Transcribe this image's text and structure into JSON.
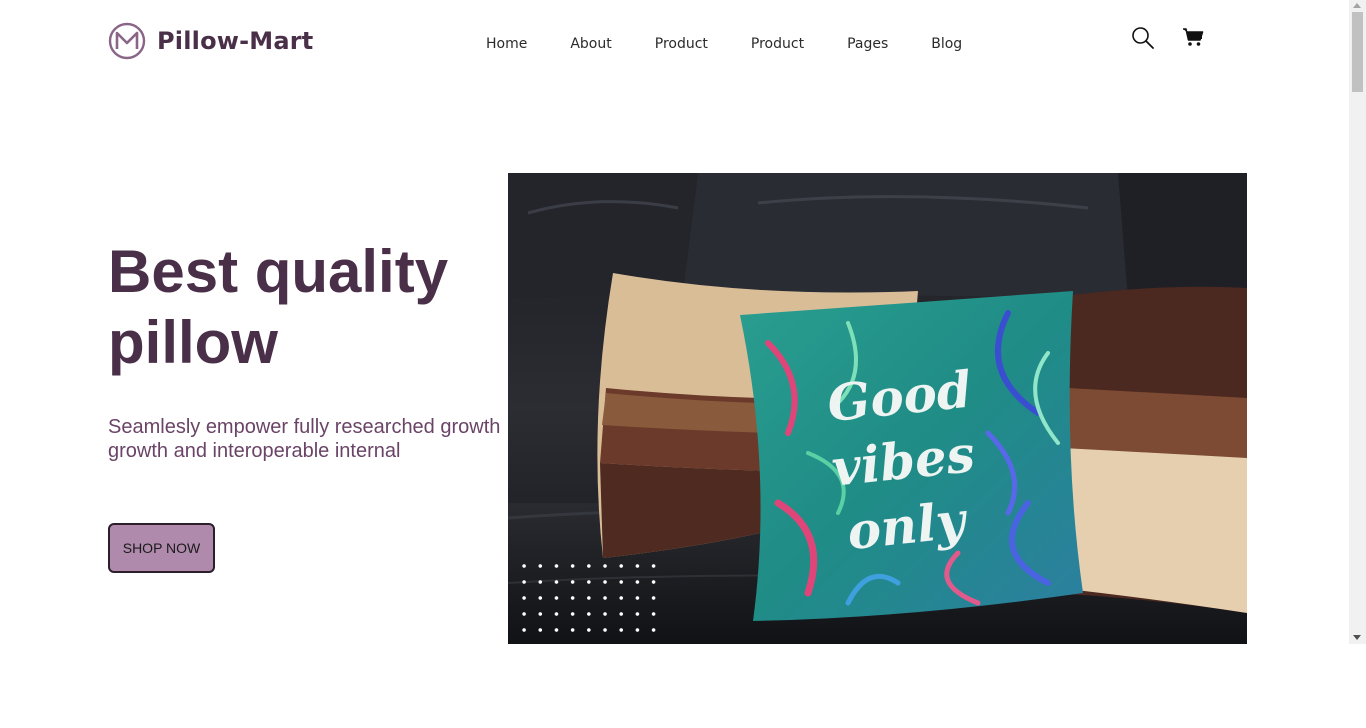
{
  "brand": {
    "name": "Pillow-Mart",
    "color": "#4a2f49"
  },
  "nav": {
    "items": [
      "Home",
      "About",
      "Product",
      "Product",
      "Pages",
      "Blog"
    ]
  },
  "header": {
    "search_icon": "search-icon",
    "cart_icon": "cart-icon"
  },
  "hero": {
    "title_line1": "Best quality",
    "title_line2": "pillow",
    "subtitle_line1": "Seamlesly empower fully researched growth",
    "subtitle_line2": "growth and interoperable internal",
    "cta_label": "SHOP NOW",
    "cta_color": "#b08aad",
    "pillow_text_line1": "Good",
    "pillow_text_line2": "vibes",
    "pillow_text_line3": "only"
  }
}
